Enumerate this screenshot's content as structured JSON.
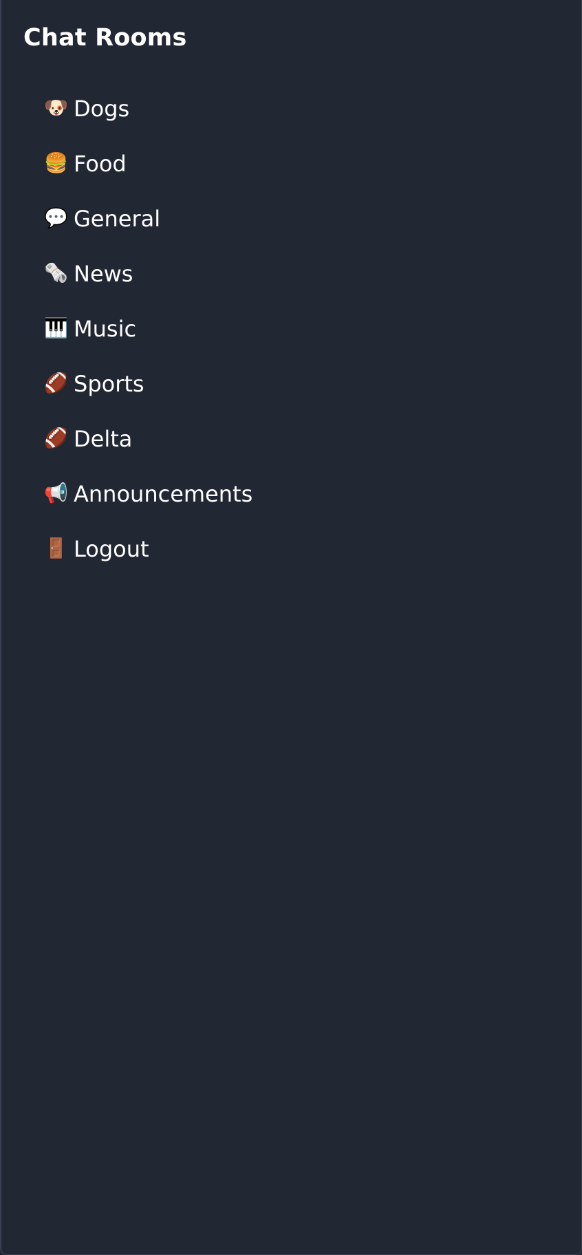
{
  "sidebar": {
    "title": "Chat Rooms",
    "items": [
      {
        "icon": "🐶",
        "icon_name": "dog-icon",
        "label": "Dogs"
      },
      {
        "icon": "🍔",
        "icon_name": "burger-icon",
        "label": "Food"
      },
      {
        "icon": "💬",
        "icon_name": "speech-bubble-icon",
        "label": "General"
      },
      {
        "icon": "🗞️",
        "icon_name": "newspaper-icon",
        "label": "News"
      },
      {
        "icon": "🎹",
        "icon_name": "piano-icon",
        "label": "Music"
      },
      {
        "icon": "🏈",
        "icon_name": "football-icon",
        "label": "Sports"
      },
      {
        "icon": "🏈",
        "icon_name": "football-icon",
        "label": "Delta"
      },
      {
        "icon": "📢",
        "icon_name": "megaphone-icon",
        "label": "Announcements"
      },
      {
        "icon": "🚪",
        "icon_name": "door-icon",
        "label": "Logout"
      }
    ]
  },
  "colors": {
    "background": "#222734",
    "text": "#ffffff"
  }
}
